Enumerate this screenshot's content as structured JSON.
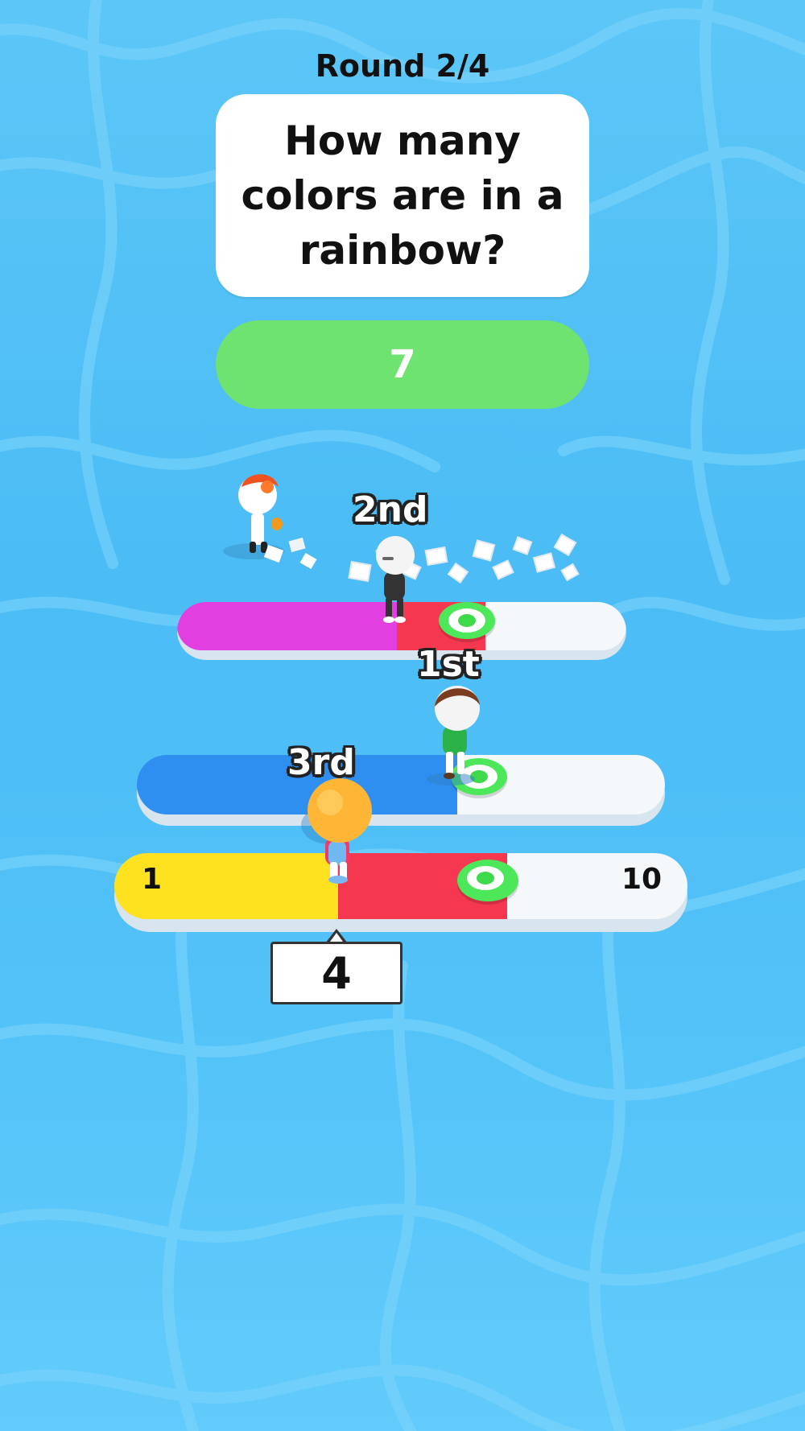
{
  "hud": {
    "round_label": "Round 2/4"
  },
  "question": {
    "text": "How many colors are in a rainbow?"
  },
  "answer": {
    "label": "7"
  },
  "players": [
    {
      "rank": "2nd",
      "color": "#e23fe0"
    },
    {
      "rank": "1st",
      "color": "#2f8ff0"
    },
    {
      "rank": "3rd",
      "color": "#ffe21f"
    }
  ],
  "scale": {
    "min_label": "1",
    "max_label": "10"
  },
  "selected_value": "4",
  "colors": {
    "answer_bg": "#6ee370",
    "wrong_zone": "#f5384f",
    "target": "#4de85a",
    "track_empty": "#f4f8fb"
  }
}
